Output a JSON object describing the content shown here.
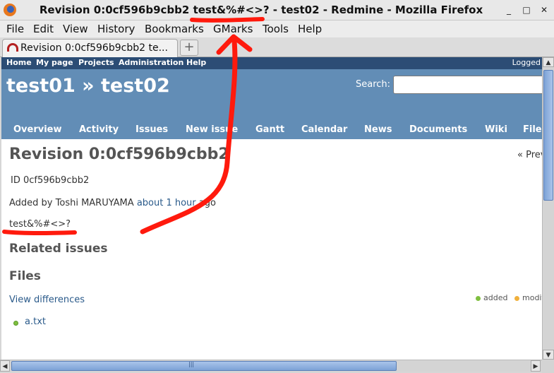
{
  "window": {
    "title": "Revision 0:0cf596b9cbb2 test&%#<>? - test02 - Redmine - Mozilla Firefox",
    "minimize": "_",
    "maximize": "□",
    "close": "✕"
  },
  "menubar": [
    "File",
    "Edit",
    "View",
    "History",
    "Bookmarks",
    "GMarks",
    "Tools",
    "Help"
  ],
  "tabs": [
    {
      "label": "Revision 0:0cf596b9cbb2 te..."
    }
  ],
  "new_tab": "+",
  "top_menu": {
    "items": [
      "Home",
      "My page",
      "Projects",
      "Administration",
      "Help"
    ],
    "logged": "Logged"
  },
  "header": {
    "project_title": "test01 » test02",
    "search_label": "Search:",
    "search_value": ""
  },
  "main_menu": [
    "Overview",
    "Activity",
    "Issues",
    "New issue",
    "Gantt",
    "Calendar",
    "News",
    "Documents",
    "Wiki",
    "Files"
  ],
  "content": {
    "title": "Revision 0:0cf596b9cbb2",
    "prev": "« Prev",
    "id_label": "ID",
    "id_value": "0cf596b9cbb2",
    "added_by": "Added by Toshi MARUYAMA",
    "added_time": "about 1 hour",
    "added_suffix": "ago",
    "message": "test&%#<>?",
    "related_heading": "Related issues",
    "files_heading": "Files",
    "view_diff": "View differences",
    "legend": {
      "added": "added",
      "modified": "modified"
    },
    "files": [
      {
        "name": "a.txt"
      }
    ]
  },
  "colors": {
    "top_menu_bg": "#2c4d75",
    "header_bg": "#628db6",
    "link": "#2a5a8a",
    "annotation": "#ff1a0d",
    "added_dot": "#7fbf3f",
    "modified_dot": "#f0b03c"
  }
}
